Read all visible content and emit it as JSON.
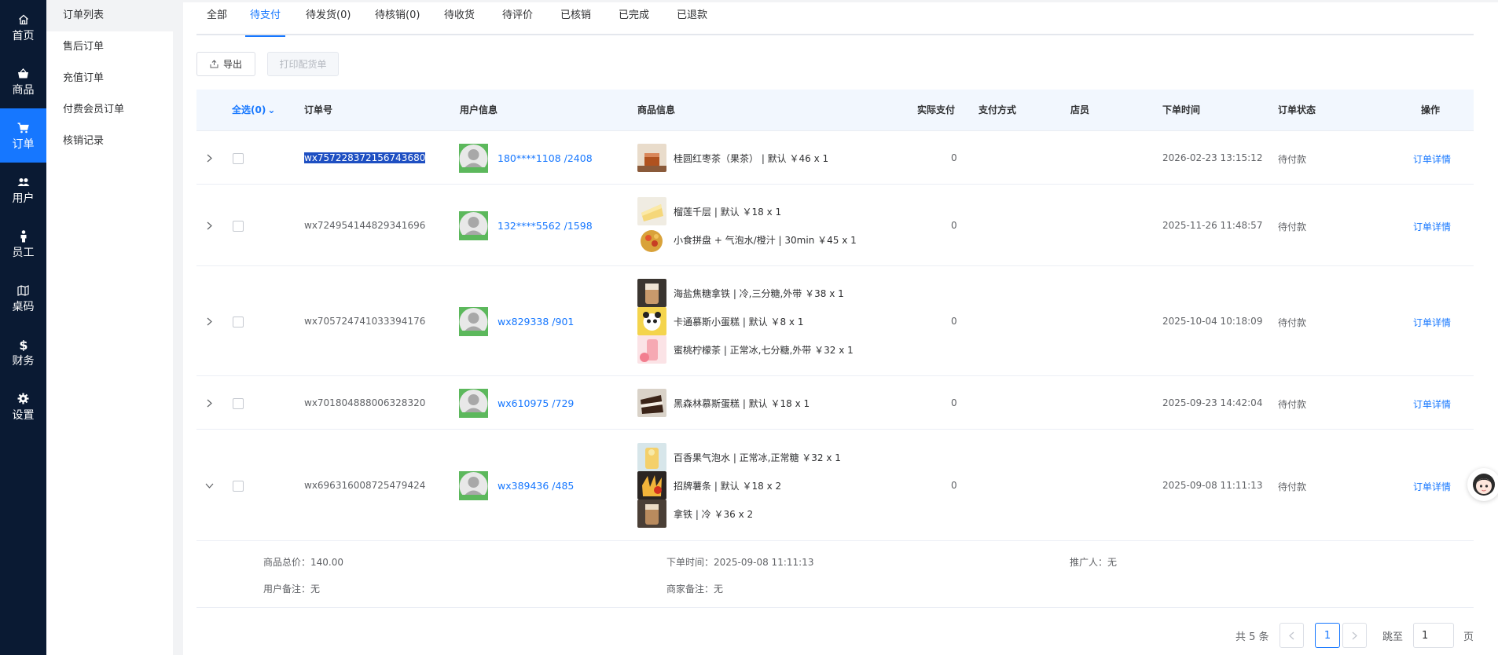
{
  "rail": {
    "items": [
      {
        "label": "首页",
        "icon": "home-icon"
      },
      {
        "label": "商品",
        "icon": "basket-icon"
      },
      {
        "label": "订单",
        "icon": "cart-icon"
      },
      {
        "label": "用户",
        "icon": "users-icon"
      },
      {
        "label": "员工",
        "icon": "person-icon"
      },
      {
        "label": "桌码",
        "icon": "map-icon"
      },
      {
        "label": "财务",
        "icon": "dollar-icon"
      },
      {
        "label": "设置",
        "icon": "gear-icon"
      }
    ],
    "active_color": "#1677ff",
    "bg_color": "#0a1a33"
  },
  "submenu": {
    "items": [
      "订单列表",
      "售后订单",
      "充值订单",
      "付费会员订单",
      "核销记录"
    ]
  },
  "tabs": [
    "全部",
    "待支付",
    "待发货(0)",
    "待核销(0)",
    "待收货",
    "待评价",
    "已核销",
    "已完成",
    "已退款"
  ],
  "toolbar": {
    "export_label": "导出",
    "print_label": "打印配货单"
  },
  "table": {
    "select_all": "全选(0)",
    "headers": {
      "order_no": "订单号",
      "user": "用户信息",
      "goods": "商品信息",
      "paid": "实际支付",
      "pay_method": "支付方式",
      "clerk": "店员",
      "time": "下单时间",
      "status": "订单状态",
      "action": "操作"
    },
    "rows": [
      {
        "order_no": "wx757228372156743680",
        "user": "180****1108 /2408",
        "goods": [
          "桂圆红枣茶（果茶） | 默认 ￥46 x 1"
        ],
        "paid": "0",
        "time": "2026-02-23 13:15:12",
        "status": "待付款",
        "action": "订单详情"
      },
      {
        "order_no": "wx724954144829341696",
        "user": "132****5562 /1598",
        "goods": [
          "榴莲千层 | 默认 ￥18 x 1",
          "小食拼盘 + 气泡水/橙汁 | 30min ￥45 x 1"
        ],
        "paid": "0",
        "time": "2025-11-26 11:48:57",
        "status": "待付款",
        "action": "订单详情"
      },
      {
        "order_no": "wx705724741033394176",
        "user": "wx829338 /901",
        "goods": [
          "海盐焦糖拿铁 | 冷,三分糖,外带 ￥38 x 1",
          "卡通慕斯小蛋糕 | 默认 ￥8 x 1",
          "蜜桃柠檬茶 | 正常冰,七分糖,外带 ￥32 x 1"
        ],
        "paid": "0",
        "time": "2025-10-04 10:18:09",
        "status": "待付款",
        "action": "订单详情"
      },
      {
        "order_no": "wx701804888006328320",
        "user": "wx610975 /729",
        "goods": [
          "黑森林慕斯蛋糕 | 默认 ￥18 x 1"
        ],
        "paid": "0",
        "time": "2025-09-23 14:42:04",
        "status": "待付款",
        "action": "订单详情"
      },
      {
        "order_no": "wx696316008725479424",
        "user": "wx389436 /485",
        "goods": [
          "百香果气泡水 | 正常冰,正常糖 ￥32 x 1",
          "招牌薯条 | 默认 ￥18 x 2",
          "拿铁 | 冷 ￥36 x 2"
        ],
        "paid": "0",
        "time": "2025-09-08 11:11:13",
        "status": "待付款",
        "action": "订单详情"
      }
    ]
  },
  "expanded": {
    "total_price": "商品总价：140.00",
    "order_time": "下单时间：2025-09-08 11:11:13",
    "promoter": "推广人：无",
    "user_note": "用户备注：无",
    "merchant_note": "商家备注：无"
  },
  "pagination": {
    "total": "共 5 条",
    "current_page": "1",
    "jump_label": "跳至",
    "jump_value": "1",
    "page_label": "页"
  }
}
